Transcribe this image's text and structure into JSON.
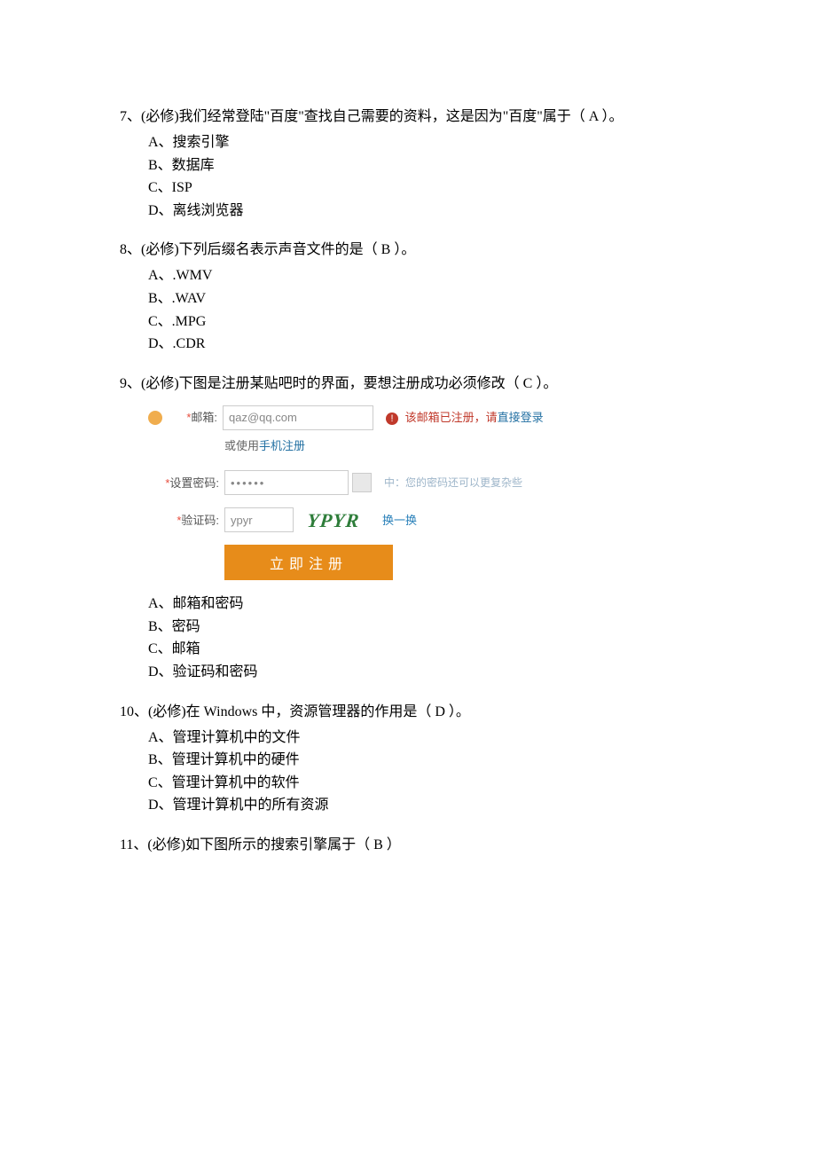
{
  "q7": {
    "text": "7、(必修)我们经常登陆\"百度\"查找自己需要的资料，这是因为\"百度\"属于（  A   ）。",
    "a": "A、搜索引擎",
    "b": "B、数据库",
    "c": "C、ISP",
    "d": "D、离线浏览器"
  },
  "q8": {
    "text": "8、(必修)下列后缀名表示声音文件的是（  B    ）。",
    "a": "A、.WMV",
    "b": "B、.WAV",
    "c": "C、.MPG",
    "d": "D、.CDR"
  },
  "q9": {
    "text": "9、(必修)下图是注册某贴吧时的界面，要想注册成功必须修改（  C     ）。",
    "a": "A、邮箱和密码",
    "b": "B、密码",
    "c": "C、邮箱",
    "d": "D、验证码和密码"
  },
  "form": {
    "email_label": "邮箱:",
    "email_value": "qaz@qq.com",
    "email_err": "该邮箱已注册，请",
    "email_err_link": "直接登录",
    "alt_prefix": "或使用",
    "alt_link": "手机注册",
    "pwd_label": "设置密码:",
    "pwd_value": "••••••",
    "pwd_msg": "中：您的密码还可以更复杂些",
    "captcha_label": "验证码:",
    "captcha_value": "ypyr",
    "captcha_img": "YPYR",
    "change": "换一换",
    "submit": "立即注册"
  },
  "q10": {
    "text": "10、(必修)在 Windows 中，资源管理器的作用是（   D  ）。",
    "a": "A、管理计算机中的文件",
    "b": "B、管理计算机中的硬件",
    "c": "C、管理计算机中的软件",
    "d": "D、管理计算机中的所有资源"
  },
  "q11": {
    "text": "11、(必修)如下图所示的搜索引擎属于（   B    ）"
  }
}
